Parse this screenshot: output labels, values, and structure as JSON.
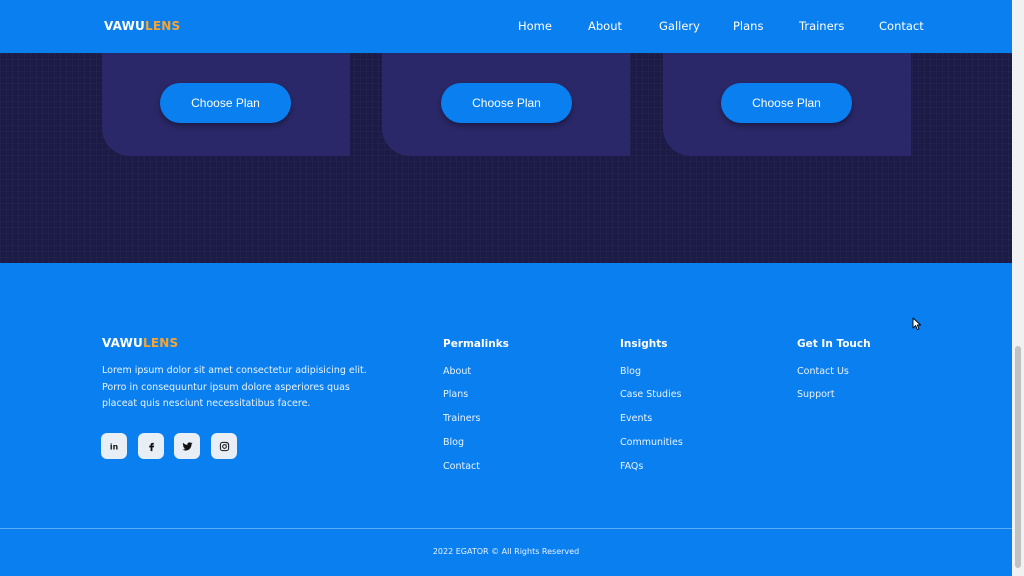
{
  "brand": {
    "part1": "VAWU",
    "part2": "LENS"
  },
  "nav": [
    {
      "label": "Home"
    },
    {
      "label": "About"
    },
    {
      "label": "Gallery"
    },
    {
      "label": "Plans"
    },
    {
      "label": "Trainers"
    },
    {
      "label": "Contact"
    }
  ],
  "plans": {
    "button_label": "Choose Plan"
  },
  "footer": {
    "description": "Lorem ipsum dolor sit amet consectetur adipisicing elit. Porro in consequuntur ipsum dolore asperiores quas placeat quis nesciunt necessitatibus facere.",
    "social": [
      {
        "icon": "linkedin-icon"
      },
      {
        "icon": "facebook-icon"
      },
      {
        "icon": "twitter-icon"
      },
      {
        "icon": "instagram-icon"
      }
    ],
    "columns": [
      {
        "title": "Permalinks",
        "links": [
          "About",
          "Plans",
          "Trainers",
          "Blog",
          "Contact"
        ]
      },
      {
        "title": "Insights",
        "links": [
          "Blog",
          "Case Studies",
          "Events",
          "Communities",
          "FAQs"
        ]
      },
      {
        "title": "Get In Touch",
        "links": [
          "Contact Us",
          "Support"
        ]
      }
    ],
    "copyright": "2022 EGATOR © All Rights Reserved"
  },
  "colors": {
    "primary": "#0a7ff0",
    "accent": "#f7a531",
    "dark_bg": "#1c1b47",
    "card_bg": "#2a2868"
  }
}
